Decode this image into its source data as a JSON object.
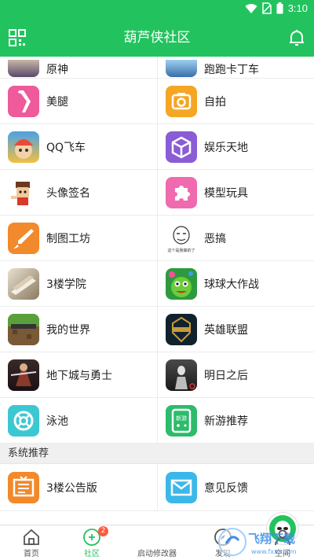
{
  "status": {
    "time": "3:10"
  },
  "app": {
    "title": "葫芦侠社区"
  },
  "partial_row": [
    "原神",
    "跑跑卡丁车"
  ],
  "grid": [
    {
      "left": "美腿",
      "right": "自拍"
    },
    {
      "left": "QQ飞车",
      "right": "娱乐天地"
    },
    {
      "left": "头像签名",
      "right": "模型玩具"
    },
    {
      "left": "制图工坊",
      "right": "恶搞"
    },
    {
      "left": "3楼学院",
      "right": "球球大作战"
    },
    {
      "left": "我的世界",
      "right": "英雄联盟"
    },
    {
      "left": "地下城与勇士",
      "right": "明日之后"
    },
    {
      "left": "泳池",
      "right": "新游推荐"
    }
  ],
  "section": {
    "title": "系统推荐"
  },
  "system": {
    "left": "3楼公告版",
    "right": "意见反馈"
  },
  "icon_text": {
    "funny_caption": "这个是我做的了",
    "newgame_caption": "新游"
  },
  "tabs": [
    {
      "label": "首页"
    },
    {
      "label": "社区",
      "badge": "2"
    },
    {
      "label": "启动修改器"
    },
    {
      "label": "发现"
    },
    {
      "label": "空间"
    }
  ],
  "watermark": {
    "text": "飞翔下载",
    "url": "www.fxxz.com"
  },
  "colors": {
    "brand": "#22c35e",
    "badge": "#ff5a3c"
  }
}
